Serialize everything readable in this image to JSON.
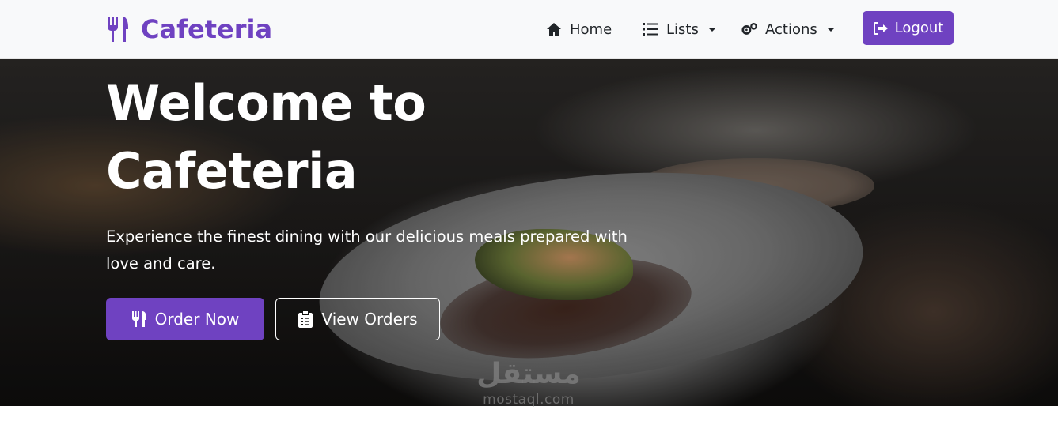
{
  "navbar": {
    "brand": "Cafeteria",
    "links": {
      "home": "Home",
      "lists": "Lists",
      "actions": "Actions"
    },
    "logout": "Logout"
  },
  "hero": {
    "title": "Welcome to Cafeteria",
    "text": "Experience the finest dining with our delicious meals prepared with love and care.",
    "order_button": "Order Now",
    "view_button": "View Orders"
  },
  "watermark": {
    "logo": "مستقل",
    "url": "mostaql.com"
  },
  "colors": {
    "accent": "#6f42c1",
    "navbar_bg": "#f8f9fa"
  },
  "icons": {
    "brand": "utensils-icon",
    "home": "home-icon",
    "lists": "list-icon",
    "actions": "gears-icon",
    "logout": "sign-out-icon",
    "order": "utensils-icon",
    "view": "clipboard-list-icon"
  }
}
